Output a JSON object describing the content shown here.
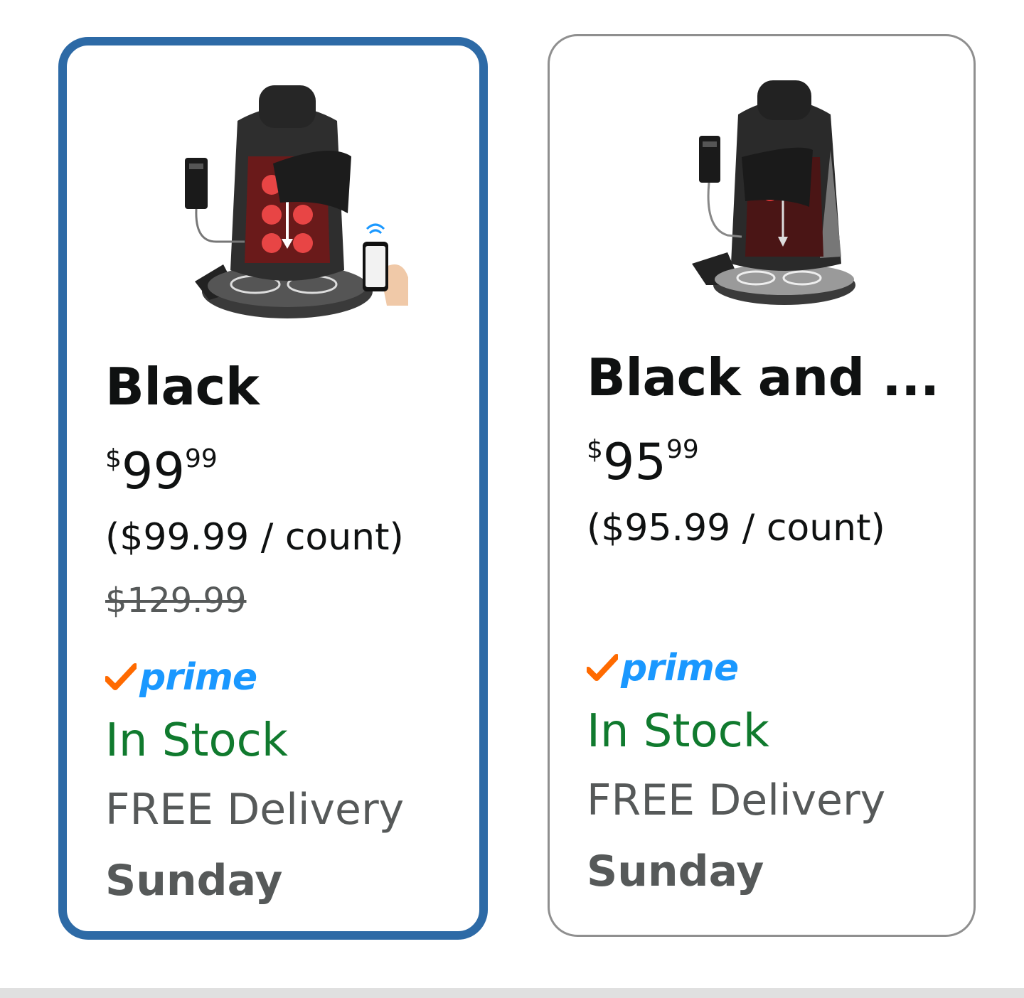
{
  "options": [
    {
      "name": "Black",
      "price": {
        "symbol": "$",
        "whole": "99",
        "fraction": "99"
      },
      "unit_price": "($99.99 / count)",
      "list_price": "$129.99",
      "prime": "prime",
      "availability": "In Stock",
      "delivery": "FREE Delivery",
      "delivery_day": "Sunday",
      "selected": true
    },
    {
      "name": "Black and ...",
      "price": {
        "symbol": "$",
        "whole": "95",
        "fraction": "99"
      },
      "unit_price": "($95.99 / count)",
      "list_price": "",
      "prime": "prime",
      "availability": "In Stock",
      "delivery": "FREE Delivery",
      "delivery_day": "Sunday",
      "selected": false
    }
  ],
  "colors": {
    "selected_border": "#2d6aa6",
    "unselected_border": "#8f8f8f",
    "in_stock": "#107a2e",
    "prime_blue": "#1a98ff",
    "prime_check": "#ff6a00",
    "muted_text": "#565959"
  },
  "icons": {
    "product_image_1": "massage-seat-cushion-with-remote-and-phone",
    "product_image_2": "massage-seat-cushion-with-remote",
    "prime_check": "prime-check-icon"
  }
}
